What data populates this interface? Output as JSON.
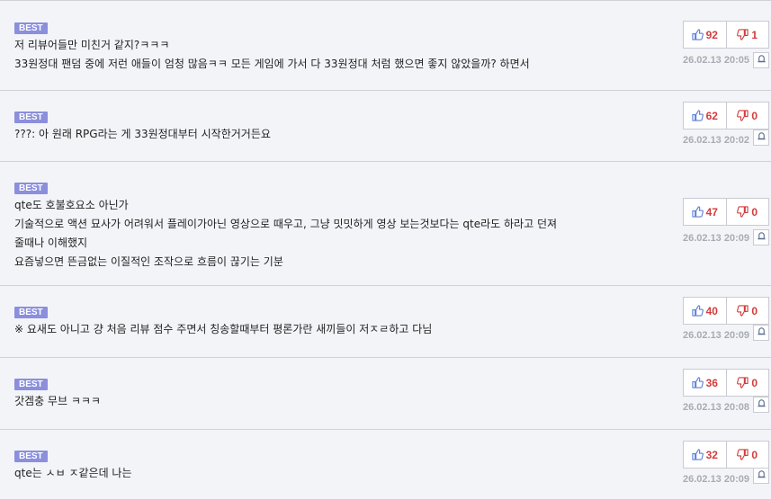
{
  "comments": [
    {
      "badge": "BEST",
      "lines": [
        "저 리뷰어들만 미친거 같지?ㅋㅋㅋ",
        "33원정대 팬덤 중에 저런 애들이 엄청 많음ㅋㅋ 모든 게임에 가서 다 33원정대 처럼 했으면 좋지 않았을까? 하면서"
      ],
      "likes": "92",
      "dislikes": "1",
      "date": "26.02.13 20:05"
    },
    {
      "badge": "BEST",
      "lines": [
        "???: 아 원래 RPG라는 게 33원정대부터 시작한거거든요"
      ],
      "likes": "62",
      "dislikes": "0",
      "date": "26.02.13 20:02"
    },
    {
      "badge": "BEST",
      "lines": [
        "qte도 호불호요소 아닌가",
        "기술적으로 액션 묘사가 어려워서 플레이가아닌 영상으로 때우고, 그냥 밋밋하게 영상 보는것보다는 qte라도 하라고 던져",
        "줄때나 이해했지",
        "요즘넣으면 뜬금없는 이질적인 조작으로 흐름이 끊기는 기분"
      ],
      "likes": "47",
      "dislikes": "0",
      "date": "26.02.13 20:09"
    },
    {
      "badge": "BEST",
      "lines": [
        "※ 요새도 아니고 걍 처음 리뷰 점수 주면서 칭송할때부터 평론가란 새끼들이 저ㅈㄹ하고 다님"
      ],
      "likes": "40",
      "dislikes": "0",
      "date": "26.02.13 20:09"
    },
    {
      "badge": "BEST",
      "lines": [
        "갓겜충 무브 ㅋㅋㅋ"
      ],
      "likes": "36",
      "dislikes": "0",
      "date": "26.02.13 20:08"
    },
    {
      "badge": "BEST",
      "lines": [
        "qte는 ㅅㅂ ㅈ같은데 나는"
      ],
      "likes": "32",
      "dislikes": "0",
      "date": "26.02.13 20:09"
    }
  ],
  "icons": {
    "like": "thumbs-up-icon",
    "dislike": "thumbs-down-icon",
    "report": "bell-icon"
  },
  "colors": {
    "badge_bg": "#8b8fdc",
    "count": "#d33b3b",
    "thumb": "#5b7fd6",
    "date": "#a9abb3",
    "divider": "#d0d2d8"
  }
}
